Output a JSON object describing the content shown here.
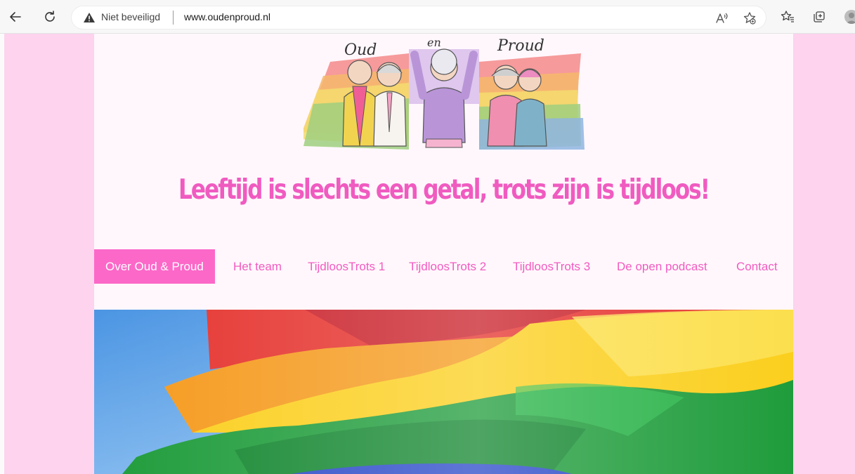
{
  "browser": {
    "security_label": "Niet beveiligd",
    "url": "www.oudenproud.nl"
  },
  "site": {
    "logo_text": [
      "Oud",
      "en",
      "Proud"
    ],
    "tagline": "Leeftijd is slechts een getal, trots zijn is tijdloos!",
    "nav": [
      {
        "label": "Over Oud & Proud",
        "active": true
      },
      {
        "label": "Het team",
        "active": false
      },
      {
        "label": "TijdloosTrots 1",
        "active": false
      },
      {
        "label": "TijdloosTrots 2",
        "active": false
      },
      {
        "label": "TijdloosTrots 3",
        "active": false
      },
      {
        "label": "De open podcast",
        "active": false
      },
      {
        "label": "Contact",
        "active": false
      }
    ],
    "colors": {
      "accent_pink": "#fc68c8",
      "text_pink": "#f25bc1",
      "page_background": "#fdd3ee",
      "content_background": "#fff7fc"
    }
  },
  "icons": [
    "back-arrow-icon",
    "refresh-icon",
    "warning-icon",
    "read-aloud-icon",
    "favorite-add-icon",
    "favorites-icon",
    "collections-icon",
    "profile-avatar"
  ]
}
